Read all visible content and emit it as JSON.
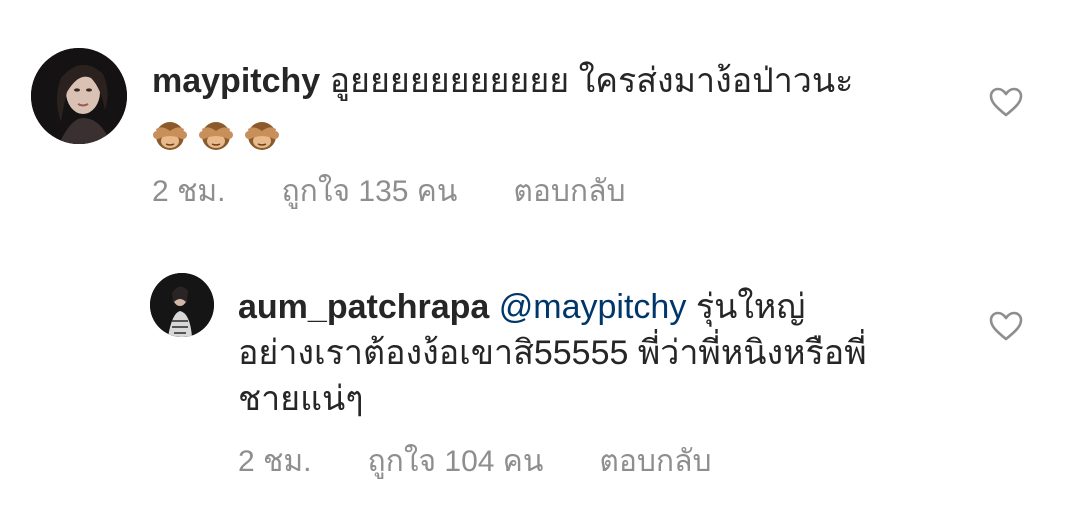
{
  "comments": [
    {
      "username": "maypitchy",
      "mention": "",
      "text": "อูยยยยยยยยยยย ใครส่งมาง้อป่าวนะ",
      "emoji": [
        "see-no-evil-monkey",
        "see-no-evil-monkey",
        "see-no-evil-monkey"
      ],
      "time": "2 ชม.",
      "likes": "ถูกใจ 135 คน",
      "reply": "ตอบกลับ"
    },
    {
      "username": "aum_patchrapa",
      "mention": "@maypitchy",
      "line1": "รุ่นใหญ่",
      "line2": "อย่างเราต้องง้อเขาสิ55555 พี่ว่าพี่หนิงหรือพี่",
      "line3": "ชายแน่ๆ",
      "time": "2 ชม.",
      "likes": "ถูกใจ 104 คน",
      "reply": "ตอบกลับ"
    }
  ],
  "icons": {
    "like": "heart-outline-icon",
    "emoji": "see-no-evil-monkey-icon"
  },
  "colors": {
    "text": "#262626",
    "secondary": "#8e8e8e",
    "mention": "#00376b"
  }
}
